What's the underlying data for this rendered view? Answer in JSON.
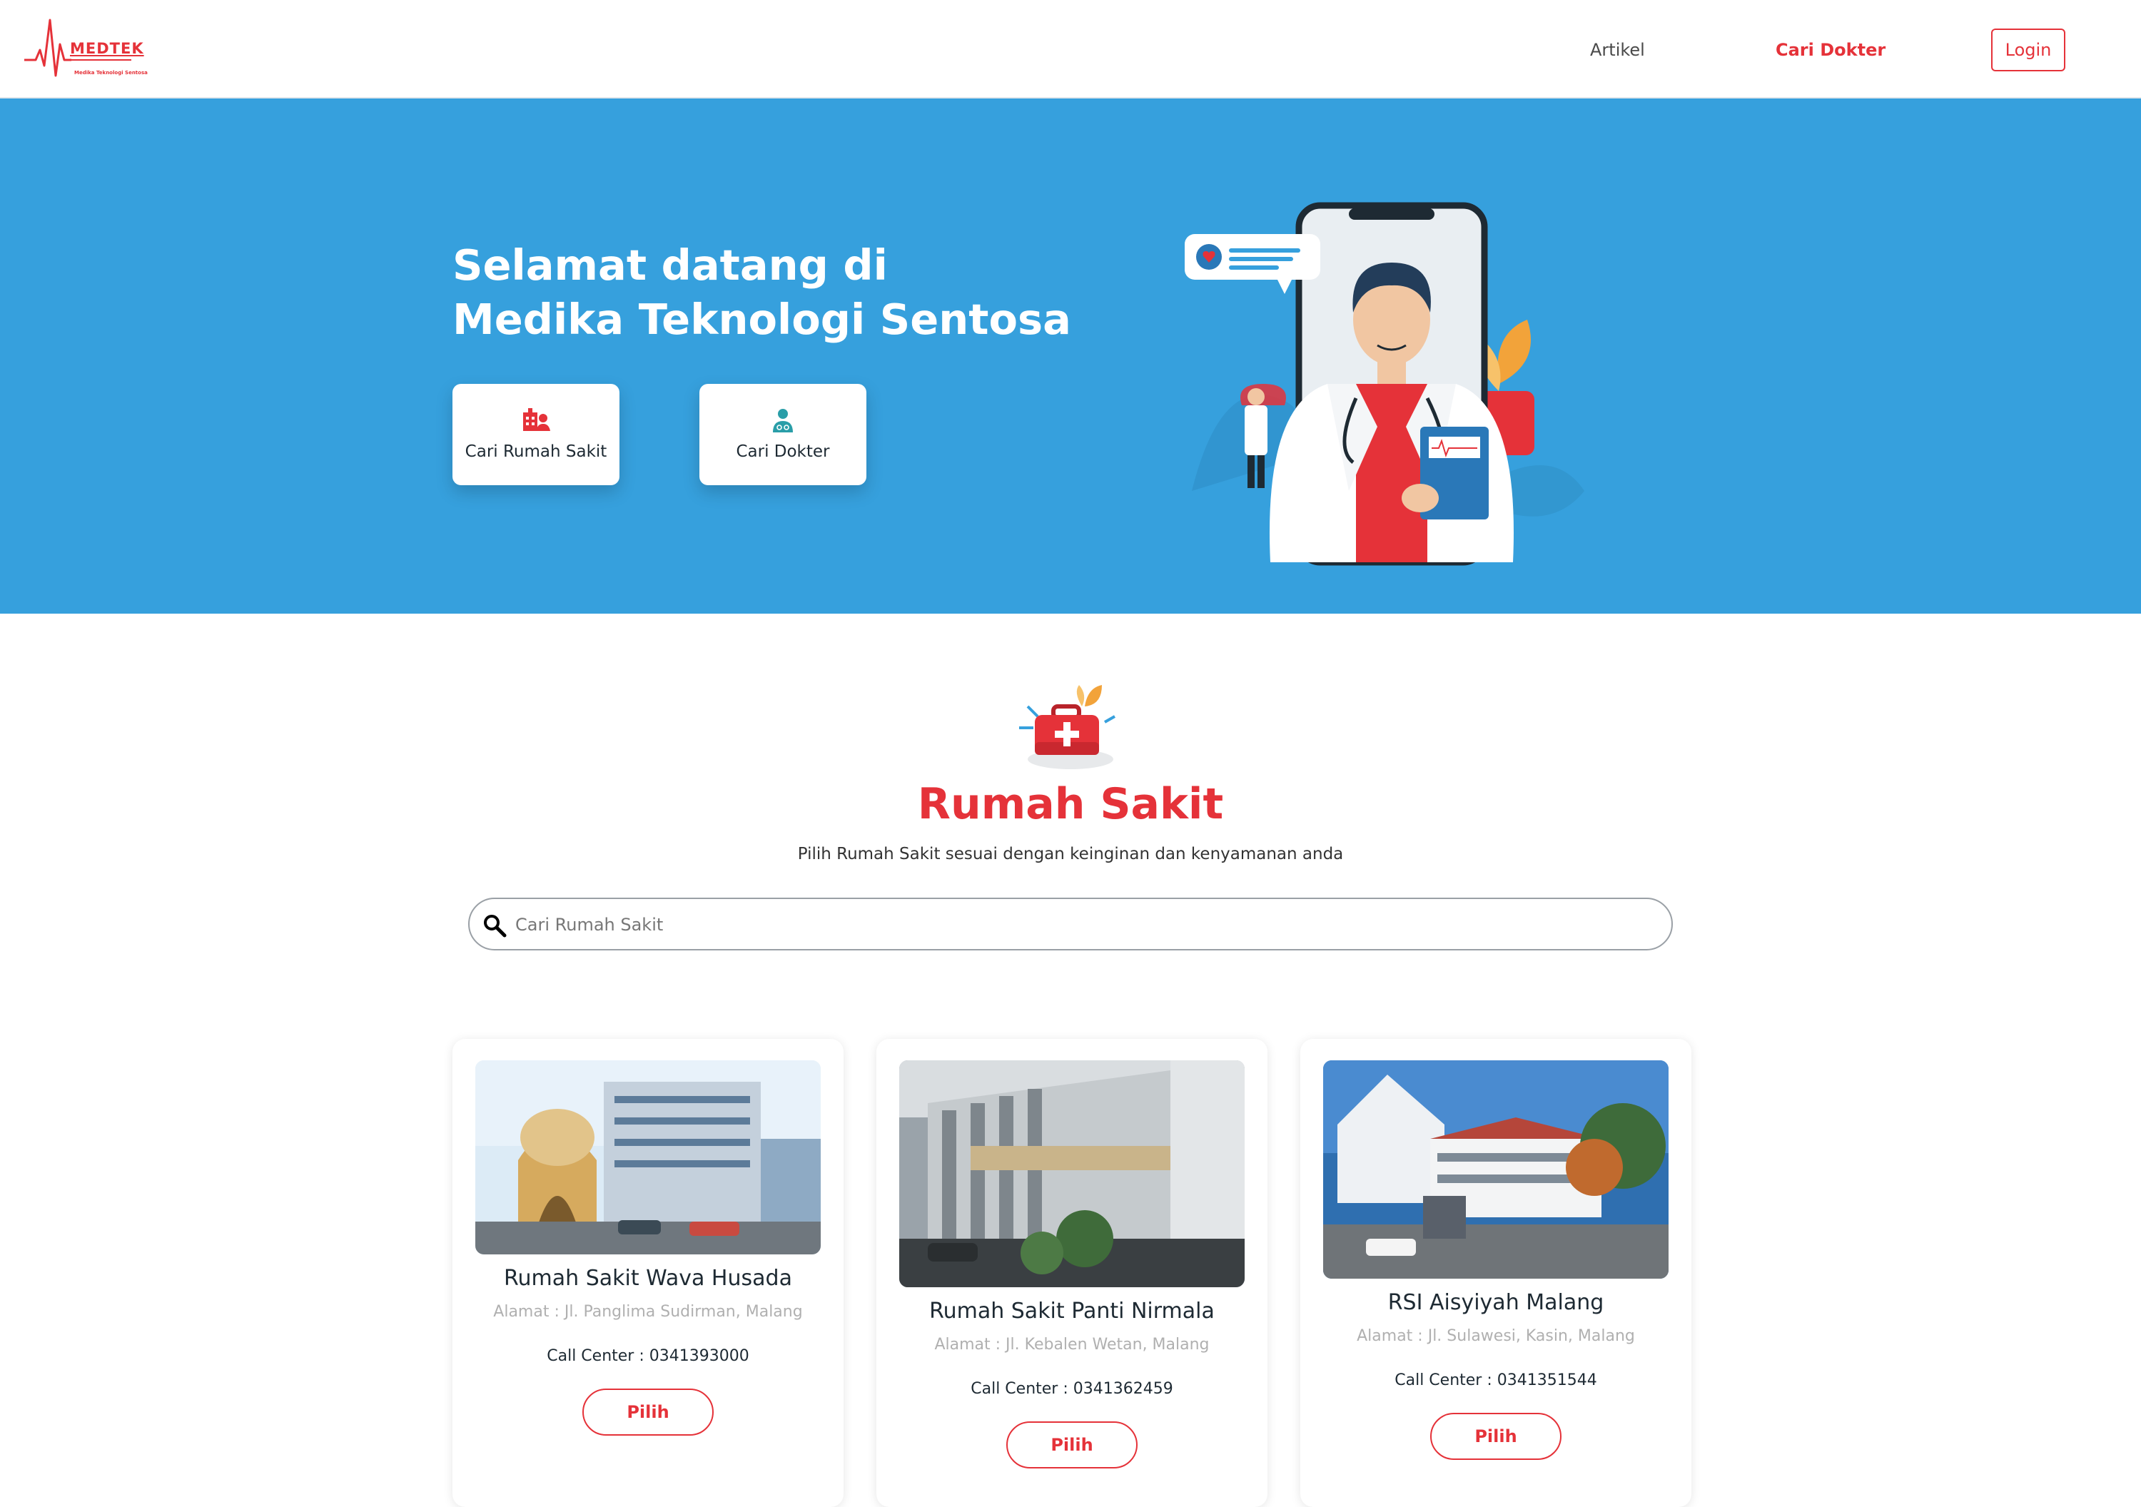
{
  "brand": {
    "name": "MEDTEK",
    "tagline": "Medika Teknologi Sentosa",
    "color": "#e53239"
  },
  "nav": {
    "artikel": "Artikel",
    "cari_dokter": "Cari Dokter",
    "login": "Login"
  },
  "hero": {
    "bg": "#36a0dd",
    "title_line1": "Selamat datang di",
    "title_line2": "Medika Teknologi Sentosa",
    "btn_rumah_sakit": "Cari Rumah Sakit",
    "btn_dokter": "Cari Dokter"
  },
  "section": {
    "title": "Rumah Sakit",
    "subtitle": "Pilih Rumah Sakit sesuai dengan keinginan dan kenyamanan anda",
    "search_placeholder": "Cari Rumah Sakit"
  },
  "hospitals": [
    {
      "name": "Rumah Sakit Wava Husada",
      "address": "Alamat : Jl. Panglima Sudirman, Malang",
      "phone": "Call Center : 0341393000",
      "button": "Pilih"
    },
    {
      "name": "Rumah Sakit Panti Nirmala",
      "address": "Alamat : Jl. Kebalen Wetan, Malang",
      "phone": "Call Center : 0341362459",
      "button": "Pilih"
    },
    {
      "name": "RSI Aisyiyah Malang",
      "address": "Alamat : Jl. Sulawesi, Kasin, Malang",
      "phone": "Call Center : 0341351544",
      "button": "Pilih"
    }
  ]
}
